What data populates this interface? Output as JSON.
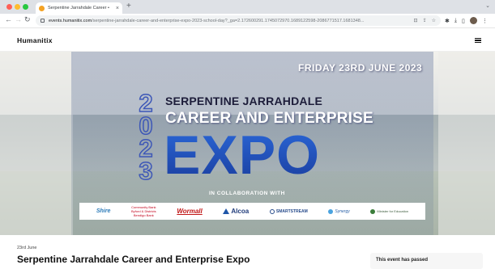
{
  "browser": {
    "tab": {
      "title": "Serpentine Jarrahdale Career •"
    },
    "new_tab_label": "+",
    "tab_menu_label": "⌄",
    "url_host": "events.humanitix.com",
    "url_path": "/serpentine-jarrahdale-career-and-enterprise-expo-2023-school-day?_ga=2.172600291.1745072970.1689122598-2086771517.1681348..."
  },
  "site": {
    "logo_text": "Humanitix",
    "menu_icon": "hamburger-icon"
  },
  "banner": {
    "date_text": "FRIDAY 23RD JUNE 2023",
    "year_digits": [
      "2",
      "0",
      "2",
      "3"
    ],
    "subtitle_top": "SERPENTINE JARRAHDALE",
    "subtitle_main": "CAREER AND ENTERPRISE",
    "headline": "EXPO",
    "collab_text": "IN COLLABORATION WITH",
    "sponsors": {
      "shire": "Shire",
      "community_bank_1": "Community Bank",
      "community_bank_2": "Byford & Districts",
      "bendigo": "Bendigo Bank",
      "wormall": "Wormall",
      "alcoa": "Alcoa",
      "smartstream": "SMARTSTREAM",
      "synergy": "Synergy",
      "minister": "Minister for Education"
    }
  },
  "event": {
    "date": "23rd June",
    "title": "Serpentine Jarrahdale Career and Enterprise Expo",
    "status": "This event has passed"
  }
}
